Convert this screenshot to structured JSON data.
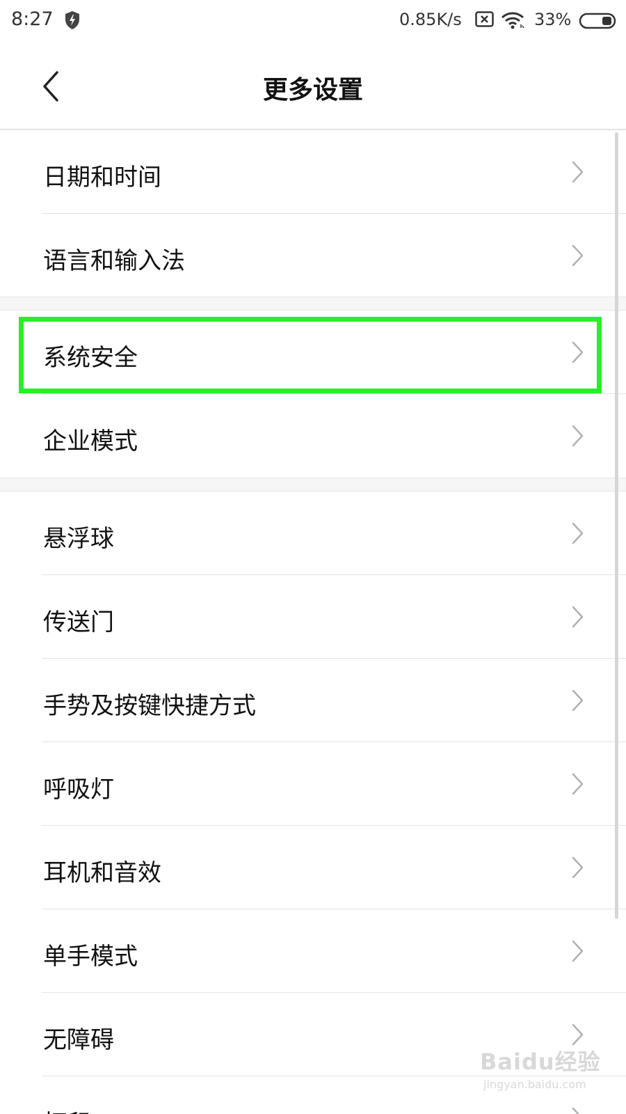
{
  "status_bar": {
    "time": "8:27",
    "net_speed": "0.85K/s",
    "battery_pct": "33%",
    "icons": [
      "shield-bolt-icon",
      "sim-off-icon",
      "wifi-icon",
      "battery-icon"
    ]
  },
  "header": {
    "title": "更多设置",
    "back_icon": "back-arrow-icon"
  },
  "groups": [
    {
      "items": [
        "日期和时间",
        "语言和输入法"
      ]
    },
    {
      "items": [
        "系统安全",
        "企业模式"
      ]
    },
    {
      "items": [
        "悬浮球",
        "传送门",
        "手势及按键快捷方式",
        "呼吸灯",
        "耳机和音效",
        "单手模式",
        "无障碍",
        "打印"
      ]
    }
  ],
  "highlighted_item": "系统安全",
  "highlight_color": "#25f02a",
  "watermark": {
    "brand": "Baidu经验",
    "url": "jingyan.baidu.com"
  }
}
